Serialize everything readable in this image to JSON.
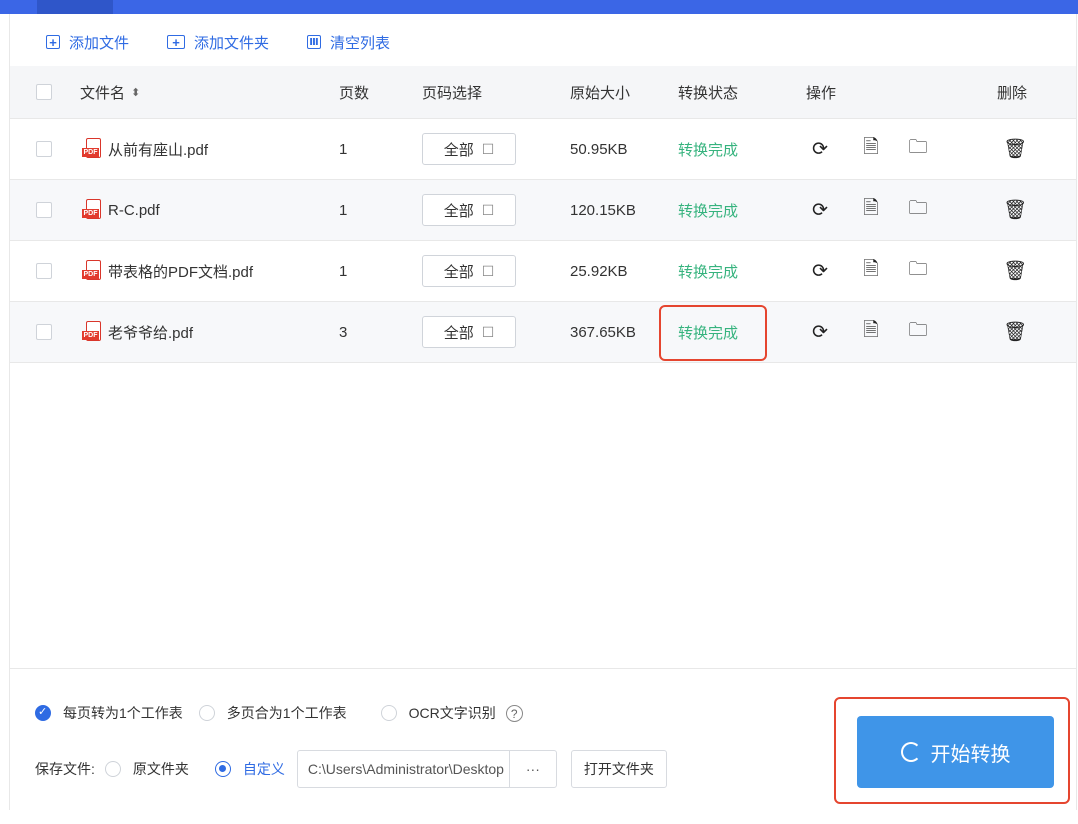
{
  "toolbar": {
    "add_file": "添加文件",
    "add_folder": "添加文件夹",
    "clear_list": "清空列表"
  },
  "table": {
    "headers": {
      "filename": "文件名",
      "pages": "页数",
      "page_select": "页码选择",
      "original_size": "原始大小",
      "status": "转换状态",
      "actions": "操作",
      "delete": "删除"
    },
    "rows": [
      {
        "name": "从前有座山.pdf",
        "pages": "1",
        "page_select": "全部",
        "size": "50.95KB",
        "status": "转换完成"
      },
      {
        "name": "R-C.pdf",
        "pages": "1",
        "page_select": "全部",
        "size": "120.15KB",
        "status": "转换完成"
      },
      {
        "name": "带表格的PDF文档.pdf",
        "pages": "1",
        "page_select": "全部",
        "size": "25.92KB",
        "status": "转换完成"
      },
      {
        "name": "老爷爷给.pdf",
        "pages": "3",
        "page_select": "全部",
        "size": "367.65KB",
        "status": "转换完成"
      }
    ]
  },
  "options": {
    "per_page": "每页转为1个工作表",
    "merge_pages": "多页合为1个工作表",
    "ocr": "OCR文字识别",
    "selected": "per_page"
  },
  "save": {
    "label": "保存文件:",
    "original_folder": "原文件夹",
    "custom": "自定义",
    "path": "C:\\Users\\Administrator\\Desktop",
    "browse": "···",
    "open_folder": "打开文件夹",
    "selected": "custom"
  },
  "start_button": "开始转换",
  "colors": {
    "accent": "#2f6be3",
    "status_done": "#36b37e",
    "start_button": "#3f95e8",
    "highlight": "#e5452f"
  }
}
